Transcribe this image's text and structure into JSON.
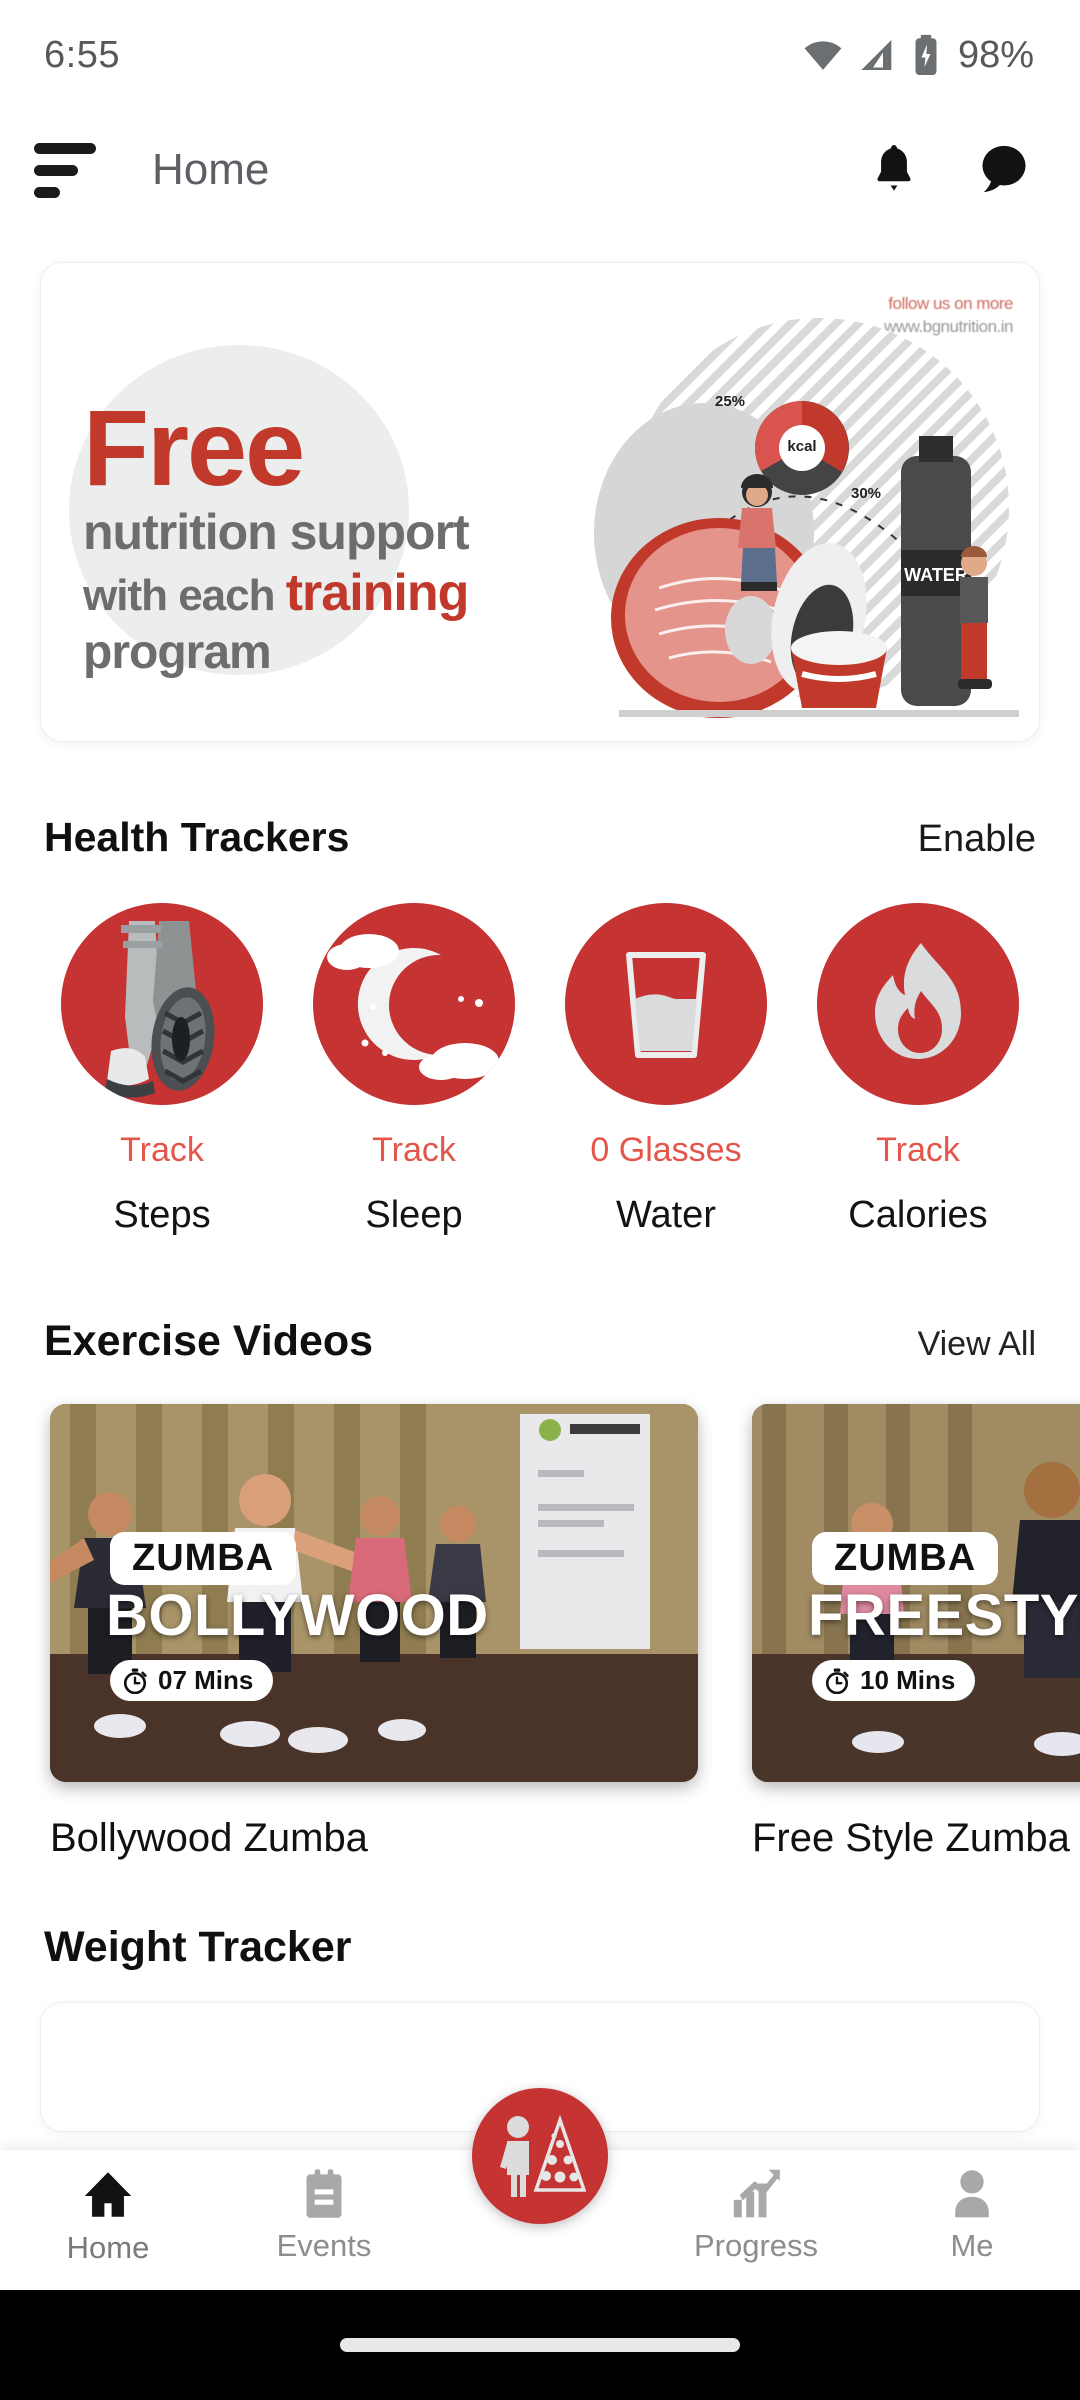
{
  "status_bar": {
    "time": "6:55",
    "battery_percent": "98%",
    "icons": [
      "wifi-icon",
      "signal-icon",
      "battery-charging-icon"
    ]
  },
  "app_bar": {
    "title": "Home",
    "menu_icon": "hamburger-menu-icon",
    "notification_icon": "bell-icon",
    "chat_icon": "chat-bubble-icon"
  },
  "banner": {
    "headline": "Free",
    "line2": "nutrition support",
    "line3_prefix": "with each ",
    "line3_bold": "training",
    "line4": "program",
    "credit_line1": "follow us on more",
    "credit_line2": "www.bgnutrition.in",
    "art_labels": {
      "kcal": "kcal",
      "pct_25": "25%",
      "pct_30": "30%",
      "water": "WATER"
    },
    "accent_color": "#c0392b"
  },
  "health_trackers": {
    "title": "Health Trackers",
    "action": "Enable",
    "items": [
      {
        "icon": "running-legs-icon",
        "value": "Track",
        "label": "Steps"
      },
      {
        "icon": "crescent-moon-icon",
        "value": "Track",
        "label": "Sleep"
      },
      {
        "icon": "water-glass-icon",
        "value": "0 Glasses",
        "label": "Water"
      },
      {
        "icon": "flame-icon",
        "value": "Track",
        "label": "Calories"
      }
    ],
    "circle_color": "#c53332",
    "value_color": "#e4564a"
  },
  "exercise_videos": {
    "title": "Exercise Videos",
    "action": "View All",
    "items": [
      {
        "badge": "ZUMBA",
        "overlay_title": "BOLLYWOOD",
        "duration": "07 Mins",
        "caption": "Bollywood Zumba",
        "timer_icon": "stopwatch-icon"
      },
      {
        "badge": "ZUMBA",
        "overlay_title": "FREESTYLE",
        "duration": "10 Mins",
        "caption": "Free Style Zumba",
        "timer_icon": "stopwatch-icon"
      }
    ]
  },
  "weight_tracker": {
    "title": "Weight Tracker"
  },
  "bottom_nav": {
    "items": [
      {
        "icon": "home-icon",
        "label": "Home",
        "active": true
      },
      {
        "icon": "events-icon",
        "label": "Events",
        "active": false
      },
      {
        "icon": "diet-plan-icon",
        "label": "",
        "active": false
      },
      {
        "icon": "progress-icon",
        "label": "Progress",
        "active": false
      },
      {
        "icon": "person-icon",
        "label": "Me",
        "active": false
      }
    ],
    "fab_icon": "nutrition-pyramid-icon",
    "fab_color": "#c53332"
  }
}
